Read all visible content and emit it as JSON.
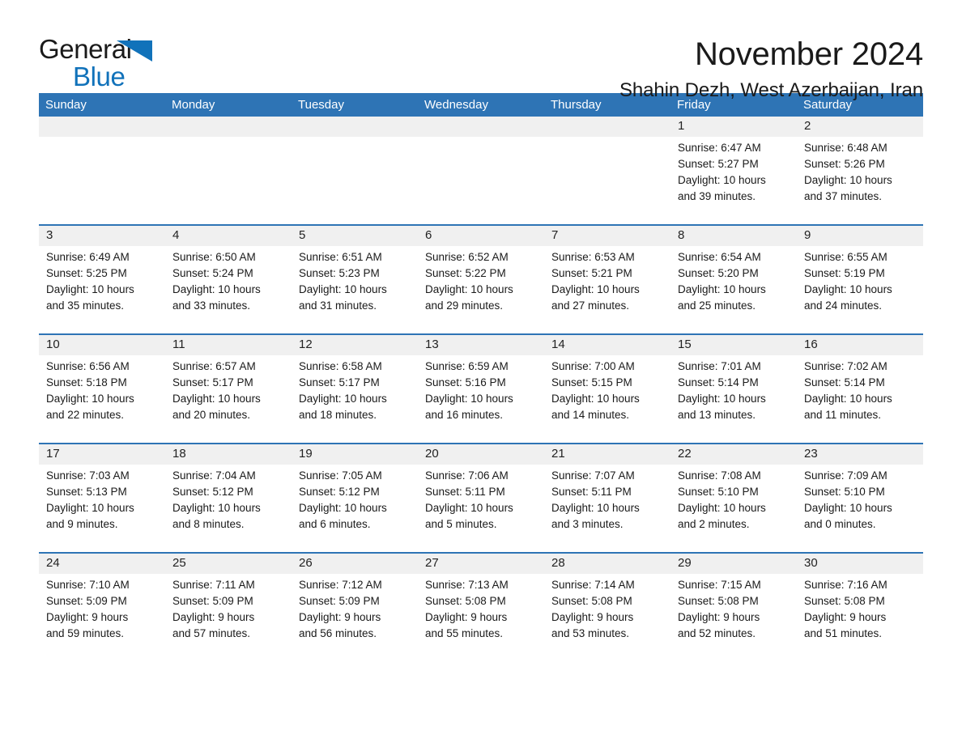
{
  "brand": {
    "name_part1": "General",
    "name_part2": "Blue",
    "accent_color": "#1172BA"
  },
  "header": {
    "title": "November 2024",
    "subtitle": "Shahin Dezh, West Azerbaijan, Iran",
    "header_bg_color": "#2E74B5",
    "date_band_color": "#F0F0F0"
  },
  "weekday_headers": [
    "Sunday",
    "Monday",
    "Tuesday",
    "Wednesday",
    "Thursday",
    "Friday",
    "Saturday"
  ],
  "weeks": [
    [
      {
        "empty": true
      },
      {
        "empty": true
      },
      {
        "empty": true
      },
      {
        "empty": true
      },
      {
        "empty": true
      },
      {
        "day": "1",
        "sunrise": "Sunrise: 6:47 AM",
        "sunset": "Sunset: 5:27 PM",
        "daylight_line1": "Daylight: 10 hours",
        "daylight_line2": "and 39 minutes."
      },
      {
        "day": "2",
        "sunrise": "Sunrise: 6:48 AM",
        "sunset": "Sunset: 5:26 PM",
        "daylight_line1": "Daylight: 10 hours",
        "daylight_line2": "and 37 minutes."
      }
    ],
    [
      {
        "day": "3",
        "sunrise": "Sunrise: 6:49 AM",
        "sunset": "Sunset: 5:25 PM",
        "daylight_line1": "Daylight: 10 hours",
        "daylight_line2": "and 35 minutes."
      },
      {
        "day": "4",
        "sunrise": "Sunrise: 6:50 AM",
        "sunset": "Sunset: 5:24 PM",
        "daylight_line1": "Daylight: 10 hours",
        "daylight_line2": "and 33 minutes."
      },
      {
        "day": "5",
        "sunrise": "Sunrise: 6:51 AM",
        "sunset": "Sunset: 5:23 PM",
        "daylight_line1": "Daylight: 10 hours",
        "daylight_line2": "and 31 minutes."
      },
      {
        "day": "6",
        "sunrise": "Sunrise: 6:52 AM",
        "sunset": "Sunset: 5:22 PM",
        "daylight_line1": "Daylight: 10 hours",
        "daylight_line2": "and 29 minutes."
      },
      {
        "day": "7",
        "sunrise": "Sunrise: 6:53 AM",
        "sunset": "Sunset: 5:21 PM",
        "daylight_line1": "Daylight: 10 hours",
        "daylight_line2": "and 27 minutes."
      },
      {
        "day": "8",
        "sunrise": "Sunrise: 6:54 AM",
        "sunset": "Sunset: 5:20 PM",
        "daylight_line1": "Daylight: 10 hours",
        "daylight_line2": "and 25 minutes."
      },
      {
        "day": "9",
        "sunrise": "Sunrise: 6:55 AM",
        "sunset": "Sunset: 5:19 PM",
        "daylight_line1": "Daylight: 10 hours",
        "daylight_line2": "and 24 minutes."
      }
    ],
    [
      {
        "day": "10",
        "sunrise": "Sunrise: 6:56 AM",
        "sunset": "Sunset: 5:18 PM",
        "daylight_line1": "Daylight: 10 hours",
        "daylight_line2": "and 22 minutes."
      },
      {
        "day": "11",
        "sunrise": "Sunrise: 6:57 AM",
        "sunset": "Sunset: 5:17 PM",
        "daylight_line1": "Daylight: 10 hours",
        "daylight_line2": "and 20 minutes."
      },
      {
        "day": "12",
        "sunrise": "Sunrise: 6:58 AM",
        "sunset": "Sunset: 5:17 PM",
        "daylight_line1": "Daylight: 10 hours",
        "daylight_line2": "and 18 minutes."
      },
      {
        "day": "13",
        "sunrise": "Sunrise: 6:59 AM",
        "sunset": "Sunset: 5:16 PM",
        "daylight_line1": "Daylight: 10 hours",
        "daylight_line2": "and 16 minutes."
      },
      {
        "day": "14",
        "sunrise": "Sunrise: 7:00 AM",
        "sunset": "Sunset: 5:15 PM",
        "daylight_line1": "Daylight: 10 hours",
        "daylight_line2": "and 14 minutes."
      },
      {
        "day": "15",
        "sunrise": "Sunrise: 7:01 AM",
        "sunset": "Sunset: 5:14 PM",
        "daylight_line1": "Daylight: 10 hours",
        "daylight_line2": "and 13 minutes."
      },
      {
        "day": "16",
        "sunrise": "Sunrise: 7:02 AM",
        "sunset": "Sunset: 5:14 PM",
        "daylight_line1": "Daylight: 10 hours",
        "daylight_line2": "and 11 minutes."
      }
    ],
    [
      {
        "day": "17",
        "sunrise": "Sunrise: 7:03 AM",
        "sunset": "Sunset: 5:13 PM",
        "daylight_line1": "Daylight: 10 hours",
        "daylight_line2": "and 9 minutes."
      },
      {
        "day": "18",
        "sunrise": "Sunrise: 7:04 AM",
        "sunset": "Sunset: 5:12 PM",
        "daylight_line1": "Daylight: 10 hours",
        "daylight_line2": "and 8 minutes."
      },
      {
        "day": "19",
        "sunrise": "Sunrise: 7:05 AM",
        "sunset": "Sunset: 5:12 PM",
        "daylight_line1": "Daylight: 10 hours",
        "daylight_line2": "and 6 minutes."
      },
      {
        "day": "20",
        "sunrise": "Sunrise: 7:06 AM",
        "sunset": "Sunset: 5:11 PM",
        "daylight_line1": "Daylight: 10 hours",
        "daylight_line2": "and 5 minutes."
      },
      {
        "day": "21",
        "sunrise": "Sunrise: 7:07 AM",
        "sunset": "Sunset: 5:11 PM",
        "daylight_line1": "Daylight: 10 hours",
        "daylight_line2": "and 3 minutes."
      },
      {
        "day": "22",
        "sunrise": "Sunrise: 7:08 AM",
        "sunset": "Sunset: 5:10 PM",
        "daylight_line1": "Daylight: 10 hours",
        "daylight_line2": "and 2 minutes."
      },
      {
        "day": "23",
        "sunrise": "Sunrise: 7:09 AM",
        "sunset": "Sunset: 5:10 PM",
        "daylight_line1": "Daylight: 10 hours",
        "daylight_line2": "and 0 minutes."
      }
    ],
    [
      {
        "day": "24",
        "sunrise": "Sunrise: 7:10 AM",
        "sunset": "Sunset: 5:09 PM",
        "daylight_line1": "Daylight: 9 hours",
        "daylight_line2": "and 59 minutes."
      },
      {
        "day": "25",
        "sunrise": "Sunrise: 7:11 AM",
        "sunset": "Sunset: 5:09 PM",
        "daylight_line1": "Daylight: 9 hours",
        "daylight_line2": "and 57 minutes."
      },
      {
        "day": "26",
        "sunrise": "Sunrise: 7:12 AM",
        "sunset": "Sunset: 5:09 PM",
        "daylight_line1": "Daylight: 9 hours",
        "daylight_line2": "and 56 minutes."
      },
      {
        "day": "27",
        "sunrise": "Sunrise: 7:13 AM",
        "sunset": "Sunset: 5:08 PM",
        "daylight_line1": "Daylight: 9 hours",
        "daylight_line2": "and 55 minutes."
      },
      {
        "day": "28",
        "sunrise": "Sunrise: 7:14 AM",
        "sunset": "Sunset: 5:08 PM",
        "daylight_line1": "Daylight: 9 hours",
        "daylight_line2": "and 53 minutes."
      },
      {
        "day": "29",
        "sunrise": "Sunrise: 7:15 AM",
        "sunset": "Sunset: 5:08 PM",
        "daylight_line1": "Daylight: 9 hours",
        "daylight_line2": "and 52 minutes."
      },
      {
        "day": "30",
        "sunrise": "Sunrise: 7:16 AM",
        "sunset": "Sunset: 5:08 PM",
        "daylight_line1": "Daylight: 9 hours",
        "daylight_line2": "and 51 minutes."
      }
    ]
  ]
}
